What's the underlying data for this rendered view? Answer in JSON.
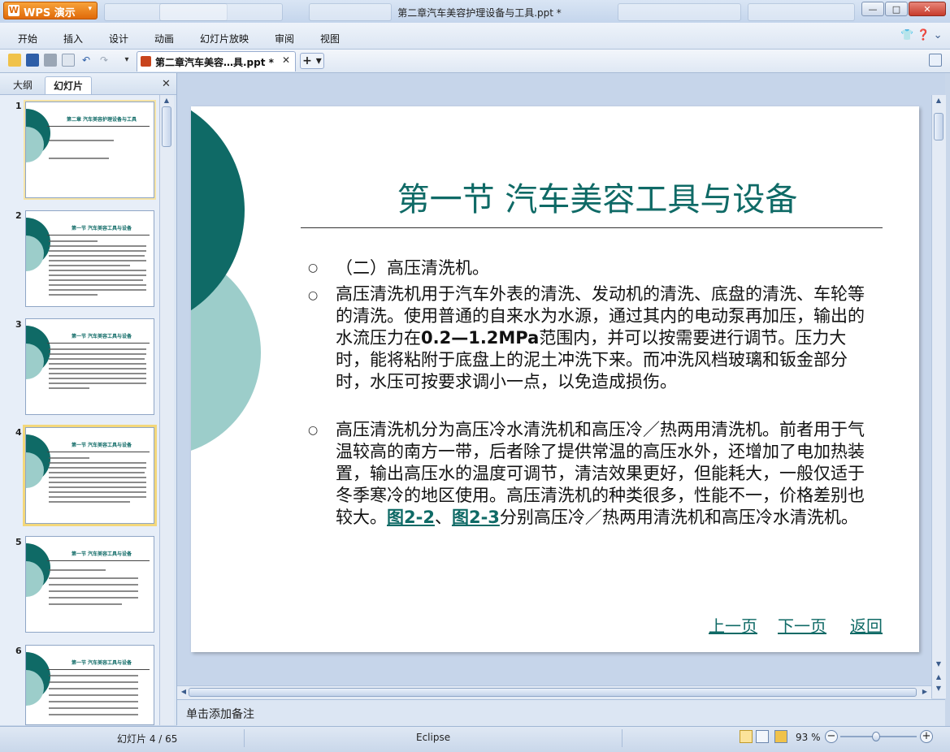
{
  "titlebar": {
    "app_button": "WPS 演示",
    "window_title": "第二章汽车美容护理设备与工具.ppt *",
    "minimize": "—",
    "maximize": "□",
    "close": "✕"
  },
  "menu": [
    "开始",
    "插入",
    "设计",
    "动画",
    "幻灯片放映",
    "审阅",
    "视图"
  ],
  "help_icons": "👕 ❓ ⌄",
  "toolbar": {
    "doc_tab_name": "第二章汽车美容…具.ppt *",
    "doc_tab_close": "✕",
    "new_tab": "+ ▾"
  },
  "left_panel": {
    "tab_outline": "大纲",
    "tab_slides": "幻灯片",
    "close": "✕",
    "thumbnails": [
      {
        "num": "1",
        "title": "第二章 汽车美容护理设备与工具"
      },
      {
        "num": "2",
        "title": "第一节 汽车美容工具与设备"
      },
      {
        "num": "3",
        "title": "第一节 汽车美容工具与设备"
      },
      {
        "num": "4",
        "title": "第一节 汽车美容工具与设备"
      },
      {
        "num": "5",
        "title": "第一节 汽车美容工具与设备"
      },
      {
        "num": "6",
        "title": "第一节 汽车美容工具与设备"
      }
    ]
  },
  "slide": {
    "title": "第一节  汽车美容工具与设备",
    "bullet_marker": "○",
    "p1": "（二）高压清洗机。",
    "p2_a": "高压清洗机用于汽车外表的清洗、发动机的清洗、底盘的清洗、车轮等的清洗。使用普通的自来水为水源，通过其内的电动泵再加压，输出的水流压力在",
    "p2_bold": "0.2—1.2MPa",
    "p2_b": "范围内，并可以按需要进行调节。压力大时，能将粘附于底盘上的泥土冲洗下来。而冲洗风档玻璃和钣金部分时，水压可按要求调小一点，以免造成损伤。",
    "p3_a": "高压清洗机分为高压冷水清洗机和高压冷／热两用清洗机。前者用于气温较高的南方一带，后者除了提供常温的高压水外，还增加了电加热装置，输出高压水的温度可调节，清洁效果更好，但能耗大，一般仅适于冬季寒冷的地区使用。高压清洗机的种类很多，性能不一，价格差别也较大。",
    "p3_link1": "图2-2",
    "p3_sep": "、",
    "p3_link2": "图2-3",
    "p3_b": "分别高压冷／热两用清洗机和高压冷水清洗机。",
    "nav_prev": "上一页",
    "nav_next": "下一页",
    "nav_back": "返回"
  },
  "notes_placeholder": "单击添加备注",
  "status": {
    "slide_counter": "幻灯片 4 / 65",
    "theme": "Eclipse",
    "zoom": "93 %",
    "zoom_minus": "−",
    "zoom_plus": "+"
  },
  "colors": {
    "accent_teal": "#0f6a66",
    "accent_light_teal": "#9ccdca",
    "wps_orange": "#e06a0a"
  }
}
